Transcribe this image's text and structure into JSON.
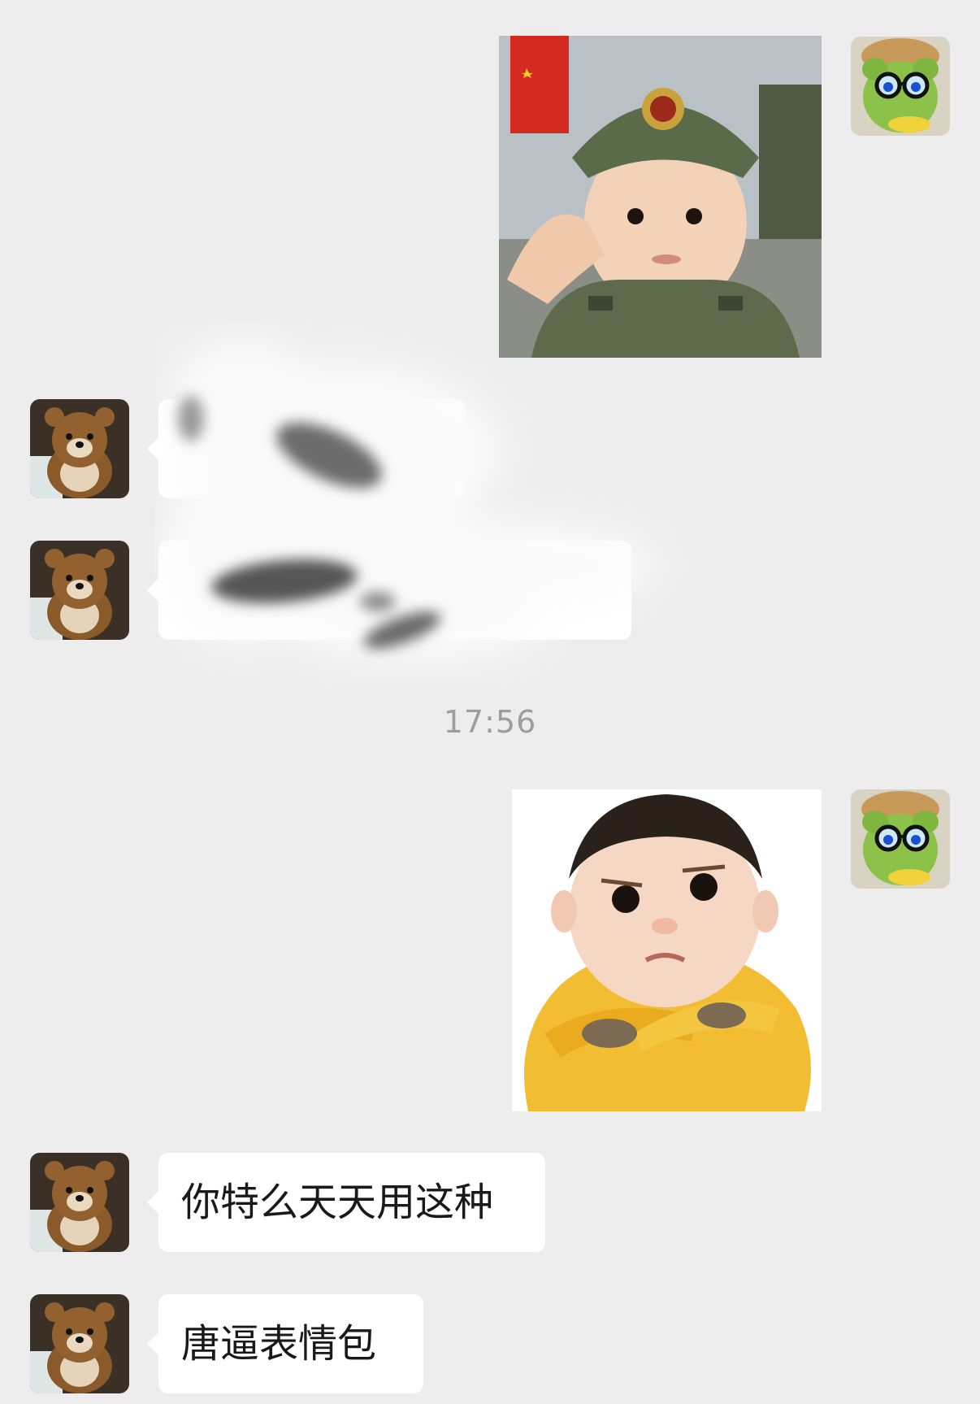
{
  "timestamp": "17:56",
  "messages": [
    {
      "side": "right",
      "type": "sticker",
      "sticker_icon": "saluting-soldier-baby-sticker"
    },
    {
      "side": "left",
      "type": "text",
      "text": ""
    },
    {
      "side": "left",
      "type": "text",
      "text": ""
    },
    {
      "side": "right",
      "type": "sticker",
      "sticker_icon": "grumpy-baby-arms-crossed-sticker"
    },
    {
      "side": "left",
      "type": "text",
      "text": "你特么天天用这种"
    },
    {
      "side": "left",
      "type": "text",
      "text": "唐逼表情包"
    }
  ],
  "avatars": {
    "self_icon": "green-plush-with-glasses-avatar",
    "contact_icon": "brown-bear-plush-avatar"
  },
  "colors": {
    "background": "#ededed",
    "bubble": "#ffffff",
    "text": "#191919",
    "timestamp": "#9d9d9d"
  }
}
